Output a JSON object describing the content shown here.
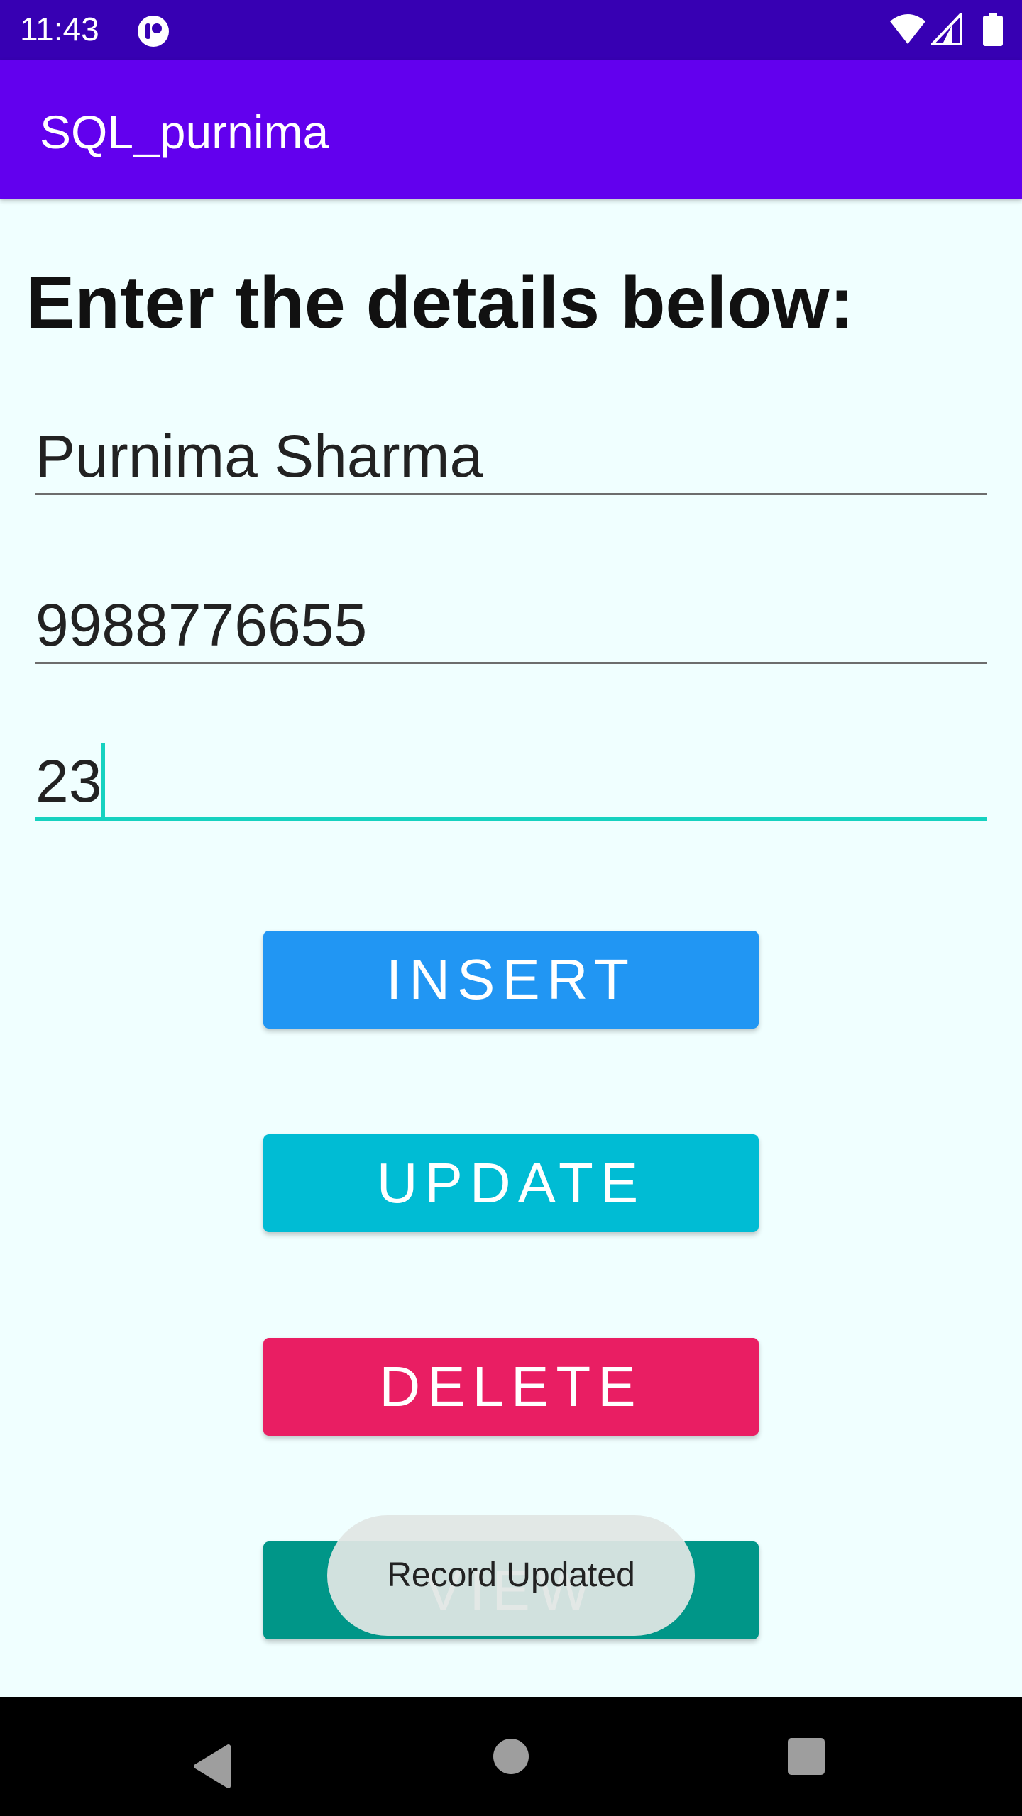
{
  "status_bar": {
    "time": "11:43",
    "icons": [
      "app-notification-icon",
      "wifi-icon",
      "cellular-signal-icon",
      "battery-icon"
    ]
  },
  "app_bar": {
    "title": "SQL_purnima"
  },
  "form": {
    "heading": "Enter the details below:",
    "name_value": "Purnima Sharma",
    "phone_value": "9988776655",
    "age_value": "23"
  },
  "buttons": {
    "insert": {
      "label": "INSERT",
      "color": "#2196f3"
    },
    "update": {
      "label": "UPDATE",
      "color": "#00bcd4"
    },
    "delete": {
      "label": "DELETE",
      "color": "#e91e63"
    },
    "view": {
      "label": "VIEW",
      "color": "#009688"
    }
  },
  "toast": {
    "message": "Record Updated"
  },
  "nav_bar": {
    "icons": [
      "back-icon",
      "home-icon",
      "recents-icon"
    ]
  },
  "colors": {
    "status_bar": "#3700b3",
    "app_bar": "#6200ee",
    "background": "#f0ffff",
    "accent": "#16d2c0"
  }
}
